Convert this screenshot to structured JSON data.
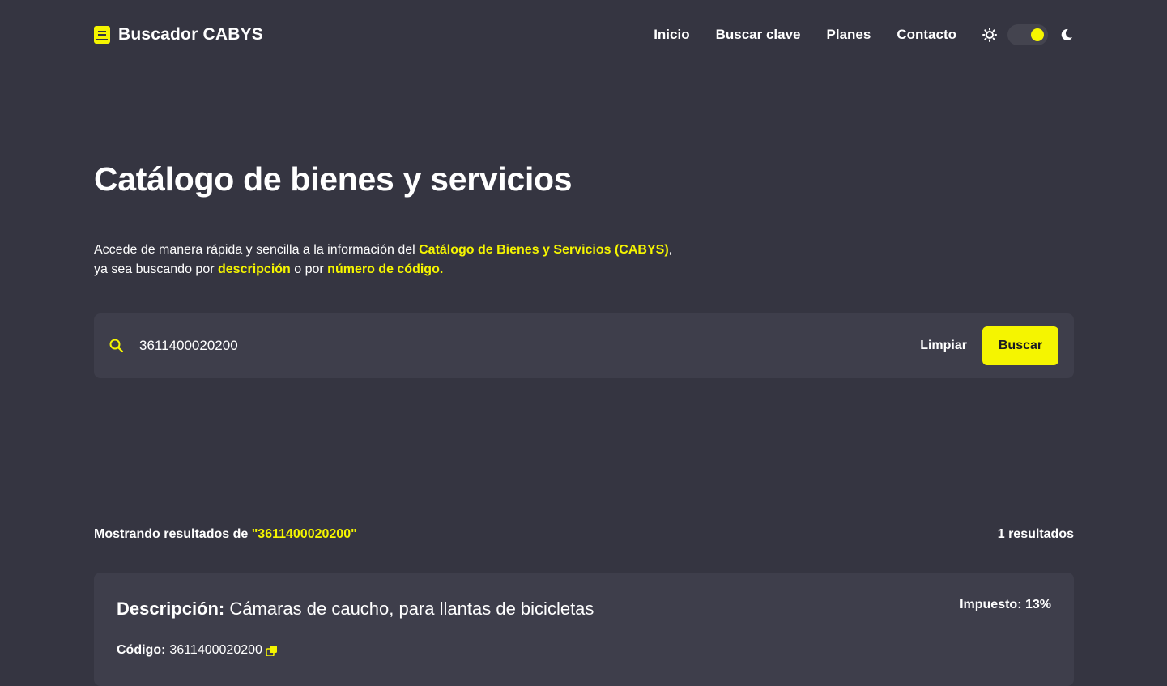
{
  "brand": {
    "name": "Buscador CABYS",
    "icon": "book-icon"
  },
  "nav": [
    {
      "label": "Inicio"
    },
    {
      "label": "Buscar clave"
    },
    {
      "label": "Planes"
    },
    {
      "label": "Contacto"
    }
  ],
  "theme": {
    "light_icon": "sun-icon",
    "dark_icon": "moon-icon",
    "mode": "dark"
  },
  "hero": {
    "title": "Catálogo de bienes y servicios",
    "line1_pre": "Accede de manera rápida y sencilla a la información del ",
    "line1_hl": "Catálogo de Bienes y Servicios (CABYS)",
    "line1_post": ",",
    "line2_pre": "ya sea buscando por ",
    "line2_hl1": "descripción",
    "line2_mid": " o por ",
    "line2_hl2": "número de código."
  },
  "search": {
    "value": "3611400020200",
    "clear_label": "Limpiar",
    "submit_label": "Buscar"
  },
  "results": {
    "prefix": "Mostrando resultados de ",
    "query": "\"3611400020200\"",
    "count_label": "1 resultados",
    "items": [
      {
        "desc_label": "Descripción:",
        "description": "Cámaras de caucho, para llantas de bicicletas",
        "tax": "Impuesto: 13%",
        "code_label": "Código:",
        "code": "3611400020200"
      }
    ]
  },
  "colors": {
    "background": "#353541",
    "surface": "#3e3e4b",
    "accent": "#f5f500"
  }
}
